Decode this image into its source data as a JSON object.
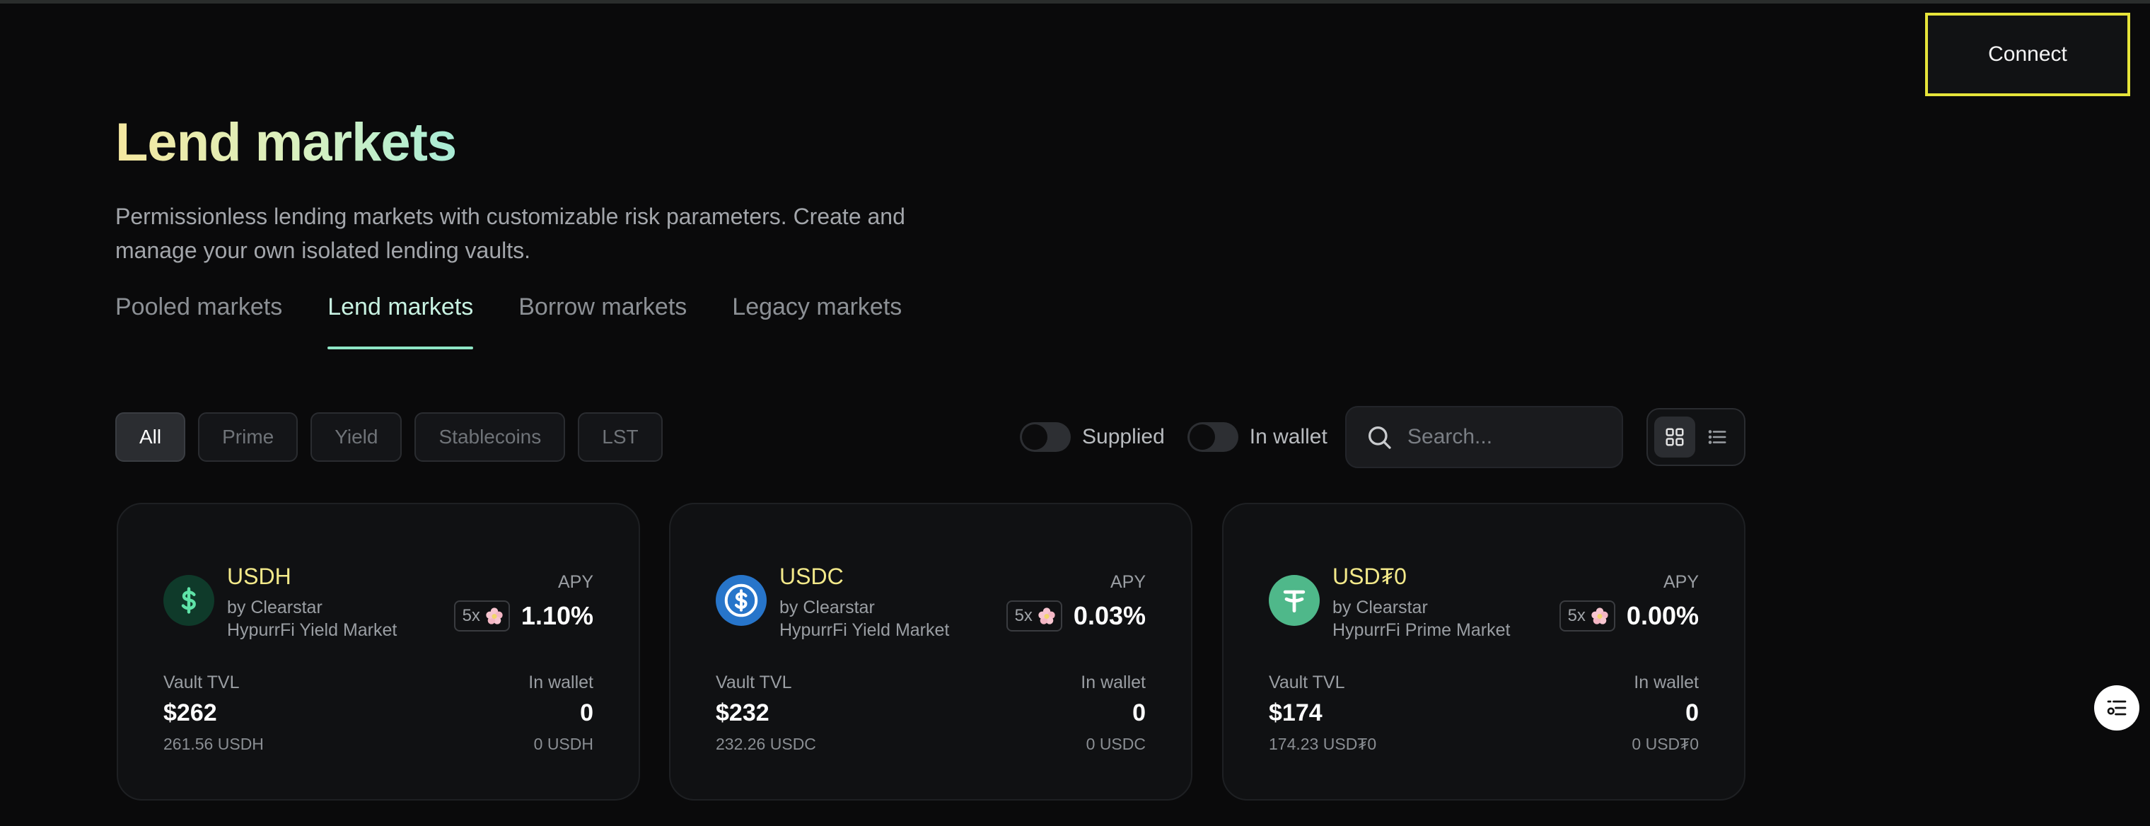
{
  "header": {
    "connect_label": "Connect"
  },
  "page": {
    "title": "Lend markets",
    "subtitle": "Permissionless lending markets with customizable risk parameters. Create and manage your own isolated lending vaults."
  },
  "tabs": [
    {
      "label": "Pooled markets",
      "active": false
    },
    {
      "label": "Lend markets",
      "active": true
    },
    {
      "label": "Borrow markets",
      "active": false
    },
    {
      "label": "Legacy markets",
      "active": false
    }
  ],
  "filters": [
    {
      "label": "All",
      "active": true
    },
    {
      "label": "Prime",
      "active": false
    },
    {
      "label": "Yield",
      "active": false
    },
    {
      "label": "Stablecoins",
      "active": false
    },
    {
      "label": "LST",
      "active": false
    }
  ],
  "toggles": {
    "supplied": {
      "label": "Supplied",
      "on": false
    },
    "in_wallet": {
      "label": "In wallet",
      "on": false
    }
  },
  "search": {
    "placeholder": "Search...",
    "value": ""
  },
  "view": {
    "mode": "grid",
    "icons": [
      "grid-view-icon",
      "list-view-icon"
    ]
  },
  "cards": [
    {
      "asset": "USDH",
      "by": "by Clearstar",
      "market": "HypurrFi Yield Market",
      "apy_label": "APY",
      "boost": "5x",
      "apy": "1.10%",
      "tvl_label": "Vault TVL",
      "tvl": "$262",
      "tvl_sub": "261.56 USDH",
      "wallet_label": "In wallet",
      "wallet": "0",
      "wallet_sub": "0 USDH",
      "icon": "usdh-coin-icon",
      "icon_color": "#0f3a2a"
    },
    {
      "asset": "USDC",
      "by": "by Clearstar",
      "market": "HypurrFi Yield Market",
      "apy_label": "APY",
      "boost": "5x",
      "apy": "0.03%",
      "tvl_label": "Vault TVL",
      "tvl": "$232",
      "tvl_sub": "232.26 USDC",
      "wallet_label": "In wallet",
      "wallet": "0",
      "wallet_sub": "0 USDC",
      "icon": "usdc-coin-icon",
      "icon_color": "#2775ca"
    },
    {
      "asset": "USD₮0",
      "by": "by Clearstar",
      "market": "HypurrFi Prime Market",
      "apy_label": "APY",
      "boost": "5x",
      "apy": "0.00%",
      "tvl_label": "Vault TVL",
      "tvl": "$174",
      "tvl_sub": "174.23 USD₮0",
      "wallet_label": "In wallet",
      "wallet": "0",
      "wallet_sub": "0 USD₮0",
      "icon": "usdt0-coin-icon",
      "icon_color": "#4fb88a"
    }
  ],
  "colors": {
    "background": "#0a0a0b",
    "accent_active_tab": "#8fe6c6",
    "asset_name": "#f3e98a",
    "connect_highlight": "#e6e43a"
  }
}
